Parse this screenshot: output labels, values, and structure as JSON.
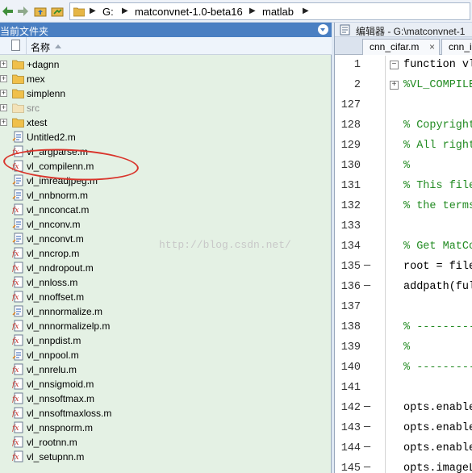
{
  "address_bar": {
    "crumbs": [
      "G:",
      "matconvnet-1.0-beta16",
      "matlab"
    ]
  },
  "current_folder": {
    "title": "当前文件夹",
    "column_name": "名称",
    "items": [
      {
        "name": "+dagnn",
        "type": "folder",
        "expandable": true,
        "dim": false
      },
      {
        "name": "mex",
        "type": "folder",
        "expandable": true,
        "dim": false
      },
      {
        "name": "simplenn",
        "type": "folder",
        "expandable": true,
        "dim": false
      },
      {
        "name": "src",
        "type": "folder",
        "expandable": true,
        "dim": true
      },
      {
        "name": "xtest",
        "type": "folder",
        "expandable": true,
        "dim": false
      },
      {
        "name": "Untitled2.m",
        "type": "script",
        "expandable": false,
        "dim": false
      },
      {
        "name": "vl_argparse.m",
        "type": "function",
        "expandable": false,
        "dim": false
      },
      {
        "name": "vl_compilenn.m",
        "type": "function",
        "expandable": false,
        "dim": false
      },
      {
        "name": "vl_imreadjpeg.m",
        "type": "script",
        "expandable": false,
        "dim": false
      },
      {
        "name": "vl_nnbnorm.m",
        "type": "script",
        "expandable": false,
        "dim": false
      },
      {
        "name": "vl_nnconcat.m",
        "type": "function",
        "expandable": false,
        "dim": false
      },
      {
        "name": "vl_nnconv.m",
        "type": "script",
        "expandable": false,
        "dim": false
      },
      {
        "name": "vl_nnconvt.m",
        "type": "script",
        "expandable": false,
        "dim": false
      },
      {
        "name": "vl_nncrop.m",
        "type": "function",
        "expandable": false,
        "dim": false
      },
      {
        "name": "vl_nndropout.m",
        "type": "function",
        "expandable": false,
        "dim": false
      },
      {
        "name": "vl_nnloss.m",
        "type": "function",
        "expandable": false,
        "dim": false
      },
      {
        "name": "vl_nnoffset.m",
        "type": "function",
        "expandable": false,
        "dim": false
      },
      {
        "name": "vl_nnnormalize.m",
        "type": "script",
        "expandable": false,
        "dim": false
      },
      {
        "name": "vl_nnnormalizelp.m",
        "type": "function",
        "expandable": false,
        "dim": false
      },
      {
        "name": "vl_nnpdist.m",
        "type": "function",
        "expandable": false,
        "dim": false
      },
      {
        "name": "vl_nnpool.m",
        "type": "script",
        "expandable": false,
        "dim": false
      },
      {
        "name": "vl_nnrelu.m",
        "type": "function",
        "expandable": false,
        "dim": false
      },
      {
        "name": "vl_nnsigmoid.m",
        "type": "function",
        "expandable": false,
        "dim": false
      },
      {
        "name": "vl_nnsoftmax.m",
        "type": "function",
        "expandable": false,
        "dim": false
      },
      {
        "name": "vl_nnsoftmaxloss.m",
        "type": "function",
        "expandable": false,
        "dim": false
      },
      {
        "name": "vl_nnspnorm.m",
        "type": "function",
        "expandable": false,
        "dim": false
      },
      {
        "name": "vl_rootnn.m",
        "type": "function",
        "expandable": false,
        "dim": false
      },
      {
        "name": "vl_setupnn.m",
        "type": "function",
        "expandable": false,
        "dim": false
      }
    ]
  },
  "editor": {
    "title": "编辑器 - G:\\matconvnet-1",
    "tabs": [
      {
        "label": "cnn_cifar.m",
        "close": "×"
      },
      {
        "label": "cnn_i"
      }
    ],
    "lines": [
      {
        "num": "1",
        "dash": "",
        "fold": "−",
        "text": "function vl",
        "kind": "code"
      },
      {
        "num": "2",
        "dash": "",
        "fold": "+",
        "text": "%VL_COMPILE",
        "kind": "comment"
      },
      {
        "num": "127",
        "dash": "",
        "fold": "",
        "text": "",
        "kind": "code"
      },
      {
        "num": "128",
        "dash": "",
        "fold": "",
        "text": "% Copyright",
        "kind": "comment"
      },
      {
        "num": "129",
        "dash": "",
        "fold": "",
        "text": "% All right",
        "kind": "comment"
      },
      {
        "num": "130",
        "dash": "",
        "fold": "",
        "text": "%",
        "kind": "comment"
      },
      {
        "num": "131",
        "dash": "",
        "fold": "",
        "text": "% This file",
        "kind": "comment"
      },
      {
        "num": "132",
        "dash": "",
        "fold": "",
        "text": "% the terms",
        "kind": "comment"
      },
      {
        "num": "133",
        "dash": "",
        "fold": "",
        "text": "",
        "kind": "code"
      },
      {
        "num": "134",
        "dash": "",
        "fold": "",
        "text": "% Get MatCo",
        "kind": "comment"
      },
      {
        "num": "135",
        "dash": "—",
        "fold": "",
        "text": "root = file",
        "kind": "code"
      },
      {
        "num": "136",
        "dash": "—",
        "fold": "",
        "text": "addpath(ful",
        "kind": "code"
      },
      {
        "num": "137",
        "dash": "",
        "fold": "",
        "text": "",
        "kind": "code"
      },
      {
        "num": "138",
        "dash": "",
        "fold": "",
        "text": "% ----------",
        "kind": "comment"
      },
      {
        "num": "139",
        "dash": "",
        "fold": "",
        "text": "%",
        "kind": "comment"
      },
      {
        "num": "140",
        "dash": "",
        "fold": "",
        "text": "% ----------",
        "kind": "comment"
      },
      {
        "num": "141",
        "dash": "",
        "fold": "",
        "text": "",
        "kind": "code"
      },
      {
        "num": "142",
        "dash": "—",
        "fold": "",
        "text": "opts.enable",
        "kind": "code"
      },
      {
        "num": "143",
        "dash": "—",
        "fold": "",
        "text": "opts.enable",
        "kind": "code"
      },
      {
        "num": "144",
        "dash": "—",
        "fold": "",
        "text": "opts.enable",
        "kind": "code"
      },
      {
        "num": "145",
        "dash": "—",
        "fold": "",
        "text": "opts.imageL",
        "kind": "code"
      }
    ]
  },
  "watermark": "http://blog.csdn.net/",
  "colors": {
    "panel_bg": "#e4f1e4",
    "header_blue": "#4a7fc2",
    "annotation_red": "#d9342b",
    "comment_green": "#228b22"
  }
}
